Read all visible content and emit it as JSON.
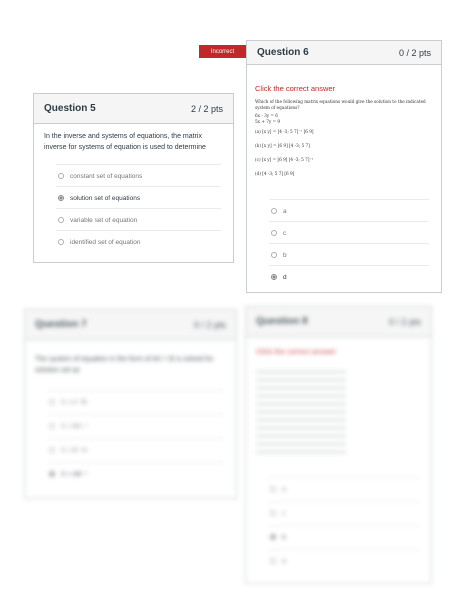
{
  "q5": {
    "title": "Question 5",
    "points": "2 / 2 pts",
    "text": "In the inverse and systems of equations, the matrix inverse for systems of equation is used to determine",
    "options": [
      {
        "label": "constant set of equations",
        "selected": false
      },
      {
        "label": "solution set of equations",
        "selected": true
      },
      {
        "label": "variable set of equation",
        "selected": false
      },
      {
        "label": "identified set of equation",
        "selected": false
      }
    ]
  },
  "q6": {
    "flag": "Incorrect",
    "title": "Question 6",
    "points": "0 / 2 pts",
    "instruction": "Click the correct answer",
    "stem": "Which of the following matrix equations would give the solution to the indicated system of equations?",
    "system": [
      "6x - 3y = 6",
      "5x + 7y = 9"
    ],
    "choices": [
      {
        "tag": "(a)",
        "expr": "[x y] = [4 -3; 5 7]⁻¹ [6 9]"
      },
      {
        "tag": "(b)",
        "expr": "[x y] = [6 9] [4 -3; 5 7]"
      },
      {
        "tag": "(c)",
        "expr": "[x y] = [6 9] [4 -3; 5 7]⁻¹"
      },
      {
        "tag": "(d)",
        "expr": "[4 -3; 5 7] [6 9]"
      }
    ],
    "options": [
      {
        "label": "a",
        "selected": false
      },
      {
        "label": "c",
        "selected": false
      },
      {
        "label": "b",
        "selected": false
      },
      {
        "label": "d",
        "selected": true
      }
    ]
  },
  "q7": {
    "title": "Question 7",
    "points": "0 / 2 pts",
    "text": "The system of equation in the form of AX = B is solved for solution set as",
    "options": [
      {
        "label": "X = A⁻¹B",
        "selected": false
      },
      {
        "label": "X = BA⁻¹",
        "selected": false
      },
      {
        "label": "X = B⁻¹A",
        "selected": false
      },
      {
        "label": "X = AB⁻¹",
        "selected": true
      }
    ]
  },
  "q8": {
    "title": "Question 8",
    "points": "0 / 2 pts",
    "instruction": "Click the correct answer",
    "options": [
      {
        "label": "a",
        "selected": false
      },
      {
        "label": "c",
        "selected": false
      },
      {
        "label": "b",
        "selected": true
      },
      {
        "label": "d",
        "selected": false
      }
    ]
  }
}
